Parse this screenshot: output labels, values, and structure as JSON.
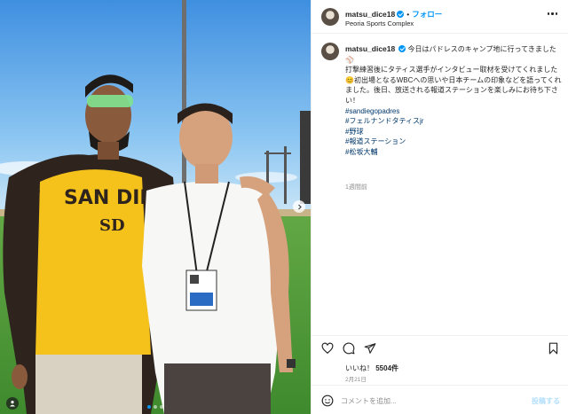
{
  "post": {
    "author": "matsu_dice18",
    "location": "Peoria Sports Complex",
    "follow_label": "フォロー",
    "separator": "•",
    "caption_lines": [
      "今日はパドレスのキャンプ地に行ってきました⚾️",
      "打撃練習後にタティス選手がインタビュー取材を受けてくれました😊初出場となるWBCへの思いや日本チームの印象などを語ってくれました。後日、放送される報道ステーションを楽しみにお待ち下さい！"
    ],
    "hashtags": [
      "#sandiegopadres",
      "#フェルナンドタティスjr",
      "#野球",
      "#報道ステーション",
      "#松坂大輔"
    ],
    "time_ago": "1週間前",
    "likes_label": "いいね！",
    "likes_count": "5504件",
    "date": "2月21日",
    "comment_placeholder": "コメントを追加...",
    "post_button": "投稿する"
  },
  "photo": {
    "jersey_text": "SAN DIEGO",
    "jersey_logo": "SD"
  },
  "icons": {
    "like": "heart-icon",
    "comment": "comment-icon",
    "share": "share-icon",
    "save": "bookmark-icon",
    "emoji": "emoji-icon",
    "more": "more-icon",
    "user_tag": "user-tag-icon",
    "next": "chevron-right-icon"
  },
  "colors": {
    "accent": "#0095f6",
    "sky": "#5aa8e6",
    "grass": "#4e9a3a",
    "padres_gold": "#f4c21b",
    "padres_brown": "#2f241d"
  }
}
